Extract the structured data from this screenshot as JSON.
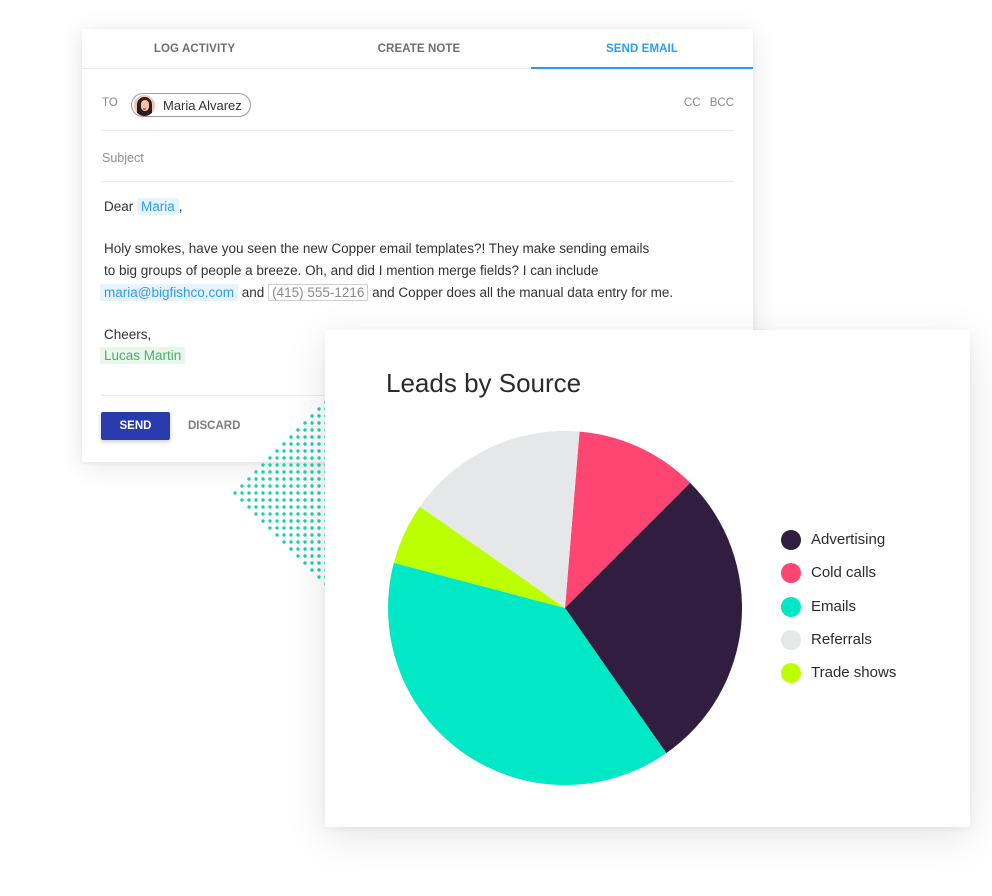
{
  "email": {
    "tabs": [
      {
        "label": "LOG ACTIVITY",
        "active": false
      },
      {
        "label": "CREATE NOTE",
        "active": false
      },
      {
        "label": "SEND EMAIL",
        "active": true
      }
    ],
    "to_label": "TO",
    "recipient": {
      "name": "Maria Alvarez",
      "avatar": "avatar-photo"
    },
    "cc_label": "CC",
    "bcc_label": "BCC",
    "subject_placeholder": "Subject",
    "body": {
      "greeting_prefix": "Dear",
      "greeting_merge": "Maria",
      "greeting_suffix": ",",
      "line1": "Holy smokes, have you seen the new Copper email templates?! They make sending emails",
      "line2": "to big groups of people a breeze. Oh, and did I mention merge fields? I can include",
      "line3_email_merge": "maria@bigfishco.com",
      "line3_and": "and",
      "line3_phone_merge": "(415) 555-1216",
      "line3_rest": "and Copper does all the manual data entry for me.",
      "signoff": "Cheers,",
      "signature_merge": "Lucas Martin"
    },
    "send_label": "SEND",
    "discard_label": "DISCARD"
  },
  "colors": {
    "accent_blue": "#2a9df4",
    "send_button": "#2a3bb0",
    "dots": "#1dd1b0"
  },
  "chart_data": {
    "type": "pie",
    "title": "Leads by Source",
    "legend_position": "right",
    "start_angle_deg": 4.7,
    "direction": "clockwise",
    "slices": [
      {
        "label": "Cold calls",
        "value": 11.2,
        "color": "#ff4673"
      },
      {
        "label": "Advertising",
        "value": 27.8,
        "color": "#311d3f"
      },
      {
        "label": "Emails",
        "value": 38.8,
        "color": "#00e8c6"
      },
      {
        "label": "Trade shows",
        "value": 5.6,
        "color": "#bbff00"
      },
      {
        "label": "Referrals",
        "value": 16.6,
        "color": "#e6e7e8"
      }
    ],
    "legend": [
      {
        "label": "Advertising",
        "color": "#311d3f"
      },
      {
        "label": "Cold calls",
        "color": "#ff4673"
      },
      {
        "label": "Emails",
        "color": "#00e8c6"
      },
      {
        "label": "Referrals",
        "color": "#e6e7e8"
      },
      {
        "label": "Trade shows",
        "color": "#bbff00"
      }
    ]
  }
}
